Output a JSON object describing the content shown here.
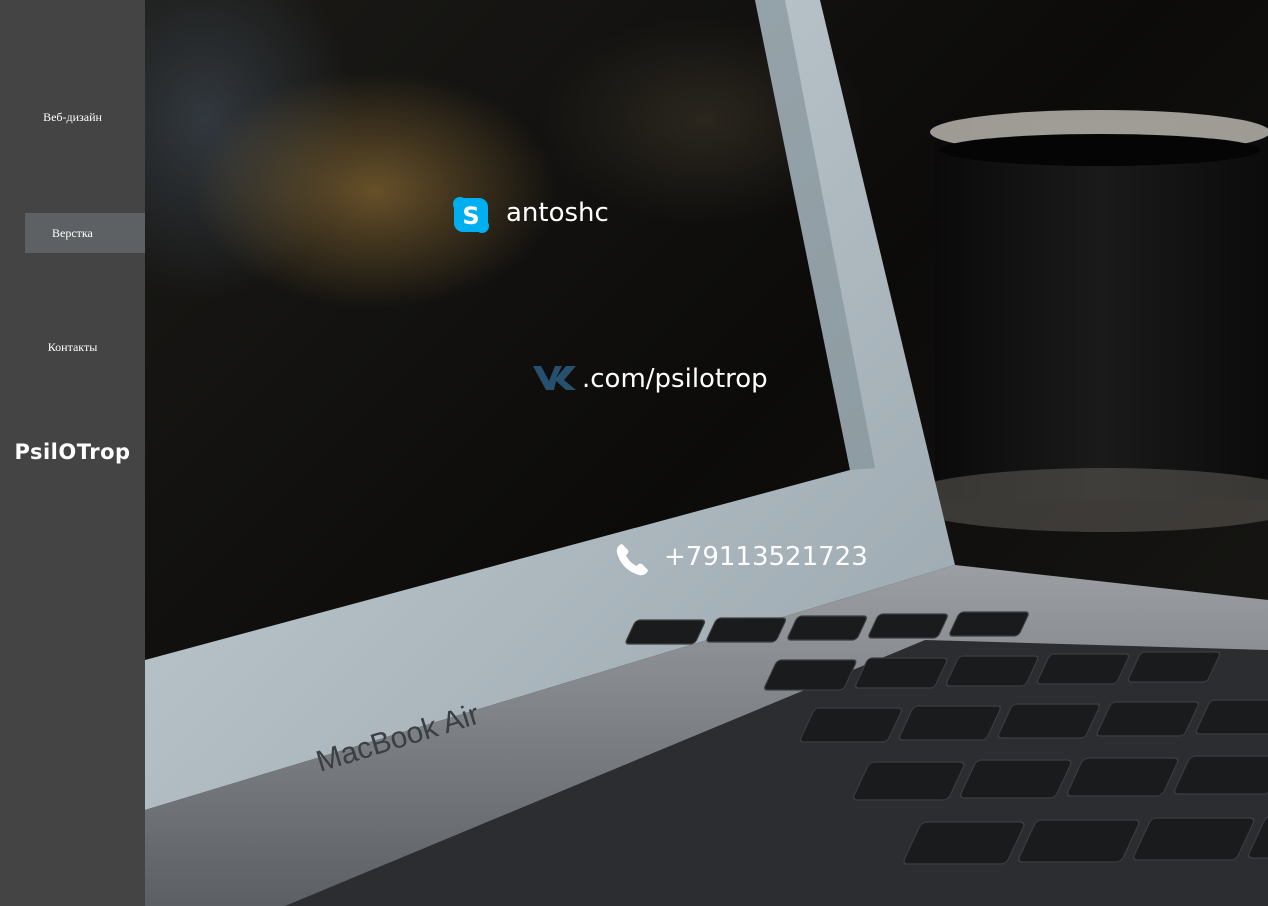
{
  "sidebar": {
    "items": [
      {
        "label": "Веб-дизайн"
      },
      {
        "label": "Верстка"
      },
      {
        "label": "Контакты"
      }
    ],
    "logo": {
      "part1": "PsilO",
      "part2": "Trop"
    }
  },
  "hero": {
    "laptop_brand": "MacBook Air"
  },
  "contacts": {
    "skype": {
      "icon": "skype-icon",
      "value": "antoshc"
    },
    "vk": {
      "icon": "vk-icon",
      "value": ".com/psilotrop"
    },
    "phone": {
      "icon": "phone-icon",
      "value": "+79113521723"
    }
  },
  "colors": {
    "sidebar_bg": "#444444",
    "active_item_bg": "#5e6163",
    "skype_blue": "#00aff0",
    "vk_blue": "#27506f"
  }
}
